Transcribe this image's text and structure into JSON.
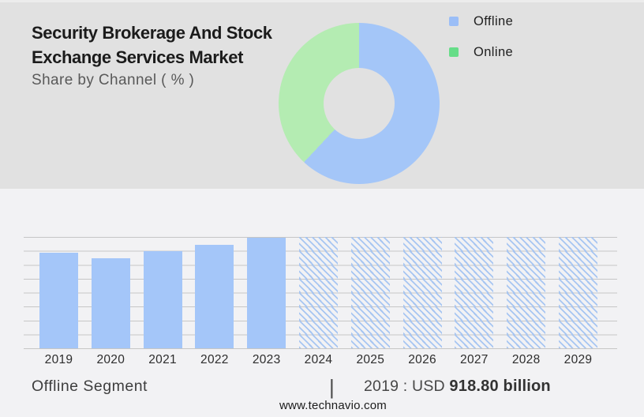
{
  "header": {
    "title": "Security Brokerage And Stock Exchange Services Market",
    "subtitle": "Share by Channel ( % )"
  },
  "legend": {
    "items": [
      {
        "label": "Offline",
        "color": "#9bbef7"
      },
      {
        "label": "Online",
        "color": "#66dd88"
      }
    ]
  },
  "footer": {
    "segment_label": "Offline Segment",
    "separator": "|",
    "value_prefix": "2019 : USD ",
    "value_bold": "918.80 billion",
    "site": "www.technavio.com"
  },
  "colors": {
    "top_background": "#e1e1e1",
    "bottom_background": "#f2f2f4",
    "bar_blue": "#a4c6f9",
    "hatch_blue": "#a6c5f2",
    "donut_blue": "#a4c6f8",
    "donut_green": "#b4ecb2",
    "gridline": "#c6c6c6"
  },
  "chart_data": [
    {
      "type": "pie",
      "subtype": "donut",
      "title": "Share by Channel ( % )",
      "labels": [
        "Offline",
        "Online"
      ],
      "values": [
        62,
        38
      ],
      "colors": [
        "#a4c6f8",
        "#b4ecb2"
      ],
      "legend_position": "top-right",
      "note": "Offline slice starts at 12 o'clock and sweeps clockwise; values estimated from arc angles"
    },
    {
      "type": "bar",
      "categories": [
        "2019",
        "2020",
        "2021",
        "2022",
        "2023",
        "2024",
        "2025",
        "2026",
        "2027",
        "2028",
        "2029"
      ],
      "values": [
        918.8,
        865,
        935,
        995,
        1066,
        null,
        null,
        null,
        null,
        null,
        null
      ],
      "unit": "USD billion",
      "xlabel": "",
      "ylabel": "",
      "ylim": [
        0,
        1070
      ],
      "grid": true,
      "bar_color": "#a4c6f9",
      "forecast_years": [
        "2024",
        "2025",
        "2026",
        "2027",
        "2028",
        "2029"
      ],
      "forecast_style": "full-height diagonal-hatched placeholder bars",
      "annotation": "2019 : USD 918.80 billion",
      "note": "only the 2019 value is printed on the graphic; 2020-2023 values estimated from bar heights"
    }
  ]
}
